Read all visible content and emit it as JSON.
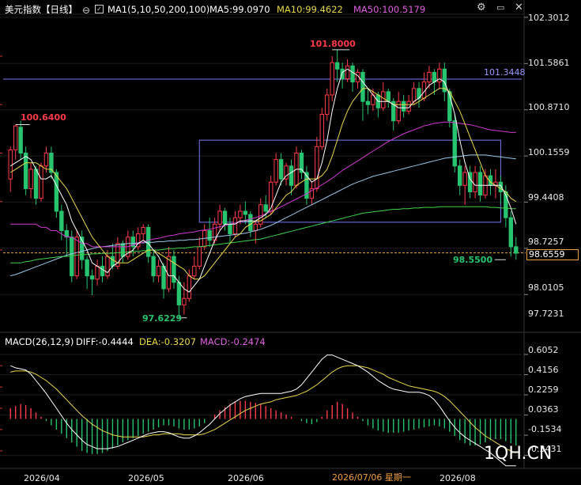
{
  "header": {
    "title": "美元指数【日线】",
    "ma_label": "MA1(5,10,50,200,100)",
    "ma5": "MA5:99.0970",
    "ma10": "MA10:99.4622",
    "ma50": "MA50:100.5179"
  },
  "macd_header": {
    "label": "MACD(26,12,9)",
    "diff": "DIFF:-0.4444",
    "dea": "DEA:-0.3207",
    "macd": "MACD:-0.2474"
  },
  "price_axis": [
    "102.3012",
    "101.5861",
    "100.8710",
    "100.1559",
    "99.4408",
    "98.7257",
    "98.0105",
    "97.7231"
  ],
  "current_price": "98.6559",
  "macd_axis": [
    "0.6052",
    "0.4156",
    "0.2259",
    "0.0363",
    "-0.1534",
    "-0.3431"
  ],
  "date_axis": [
    "2026/04",
    "2026/05",
    "2026/06",
    "2026/07/06 星期一",
    "2026/08"
  ],
  "annotations": {
    "high": "101.8000",
    "left_peak": "100.6400",
    "low": "97.6229",
    "recent_low": "98.5500",
    "hline": "101.3448"
  },
  "watermark": "1QH.CN",
  "colors": {
    "up": "#ff3b4a",
    "down": "#27c46f",
    "ma5": "#ffffff",
    "ma10": "#e8d94a",
    "ma50": "#d03ad0",
    "ma100": "#3ed34a",
    "ma200": "#9ac8e8",
    "box": "#7a78f0"
  },
  "chart_data": {
    "type": "candlestick",
    "ylim": [
      97.72,
      102.3
    ],
    "candles": [
      [
        99.8,
        100.25,
        99.6,
        100.3
      ],
      [
        100.25,
        100.62,
        100.1,
        100.64
      ],
      [
        100.6,
        100.2,
        100.1,
        100.7
      ],
      [
        100.2,
        99.65,
        99.55,
        100.3
      ],
      [
        99.65,
        99.95,
        99.5,
        100.05
      ],
      [
        99.95,
        99.5,
        99.4,
        100.0
      ],
      [
        99.5,
        100.0,
        99.45,
        100.05
      ],
      [
        100.0,
        100.2,
        99.9,
        100.3
      ],
      [
        100.2,
        99.9,
        99.8,
        100.3
      ],
      [
        99.9,
        99.3,
        99.2,
        99.95
      ],
      [
        99.3,
        99.0,
        98.85,
        99.4
      ],
      [
        99.0,
        98.9,
        98.6,
        99.1
      ],
      [
        98.9,
        98.3,
        98.2,
        99.0
      ],
      [
        98.3,
        98.9,
        98.25,
        99.0
      ],
      [
        98.9,
        98.55,
        98.4,
        99.0
      ],
      [
        98.55,
        98.3,
        98.1,
        98.6
      ],
      [
        98.3,
        98.25,
        98.0,
        98.4
      ],
      [
        98.25,
        98.45,
        98.15,
        98.55
      ],
      [
        98.45,
        98.3,
        98.2,
        98.6
      ],
      [
        98.3,
        98.6,
        98.25,
        98.7
      ],
      [
        98.6,
        98.45,
        98.4,
        98.8
      ],
      [
        98.45,
        98.8,
        98.4,
        98.9
      ],
      [
        98.8,
        98.6,
        98.5,
        98.85
      ],
      [
        98.6,
        98.9,
        98.55,
        99.0
      ],
      [
        98.9,
        98.75,
        98.6,
        99.0
      ],
      [
        98.75,
        98.95,
        98.7,
        99.05
      ],
      [
        98.95,
        99.05,
        98.85,
        99.1
      ],
      [
        99.05,
        98.6,
        98.5,
        99.1
      ],
      [
        98.6,
        98.3,
        98.2,
        98.7
      ],
      [
        98.3,
        98.45,
        98.2,
        98.55
      ],
      [
        98.45,
        98.1,
        97.95,
        98.5
      ],
      [
        98.1,
        98.6,
        98.05,
        98.75
      ],
      [
        98.6,
        98.2,
        98.1,
        98.7
      ],
      [
        98.2,
        97.85,
        97.65,
        98.3
      ],
      [
        97.85,
        97.95,
        97.7,
        98.2
      ],
      [
        97.95,
        98.3,
        97.9,
        98.4
      ],
      [
        98.3,
        98.45,
        98.25,
        98.6
      ],
      [
        98.45,
        98.75,
        98.4,
        98.9
      ],
      [
        98.75,
        99.0,
        98.7,
        99.1
      ],
      [
        99.0,
        98.85,
        98.75,
        99.2
      ],
      [
        98.85,
        99.1,
        98.8,
        99.2
      ],
      [
        99.1,
        99.3,
        99.0,
        99.4
      ],
      [
        99.3,
        99.1,
        99.0,
        99.35
      ],
      [
        99.1,
        98.95,
        98.8,
        99.2
      ],
      [
        98.95,
        99.2,
        98.9,
        99.3
      ],
      [
        99.2,
        99.3,
        99.1,
        99.4
      ],
      [
        99.3,
        99.25,
        99.1,
        99.45
      ],
      [
        99.25,
        99.0,
        98.9,
        99.3
      ],
      [
        99.0,
        99.1,
        98.8,
        99.15
      ],
      [
        99.1,
        99.4,
        99.05,
        99.5
      ],
      [
        99.4,
        99.3,
        99.2,
        99.55
      ],
      [
        99.3,
        99.75,
        99.25,
        99.85
      ],
      [
        99.75,
        100.1,
        99.7,
        100.2
      ],
      [
        100.1,
        99.8,
        99.7,
        100.2
      ],
      [
        99.8,
        100.0,
        99.7,
        100.05
      ],
      [
        100.0,
        99.7,
        99.55,
        100.1
      ],
      [
        99.7,
        100.2,
        99.65,
        100.3
      ],
      [
        100.2,
        99.9,
        99.8,
        100.25
      ],
      [
        99.9,
        99.5,
        99.4,
        100.0
      ],
      [
        99.5,
        99.65,
        99.4,
        99.75
      ],
      [
        99.65,
        100.3,
        99.6,
        100.45
      ],
      [
        100.3,
        100.8,
        100.25,
        100.9
      ],
      [
        100.8,
        101.1,
        100.7,
        101.2
      ],
      [
        101.1,
        101.6,
        101.0,
        101.7
      ],
      [
        101.6,
        101.5,
        101.3,
        101.8
      ],
      [
        101.5,
        101.35,
        101.2,
        101.6
      ],
      [
        101.35,
        101.55,
        101.3,
        101.65
      ],
      [
        101.55,
        101.3,
        101.15,
        101.6
      ],
      [
        101.3,
        101.45,
        101.2,
        101.5
      ],
      [
        101.45,
        101.0,
        100.7,
        101.5
      ],
      [
        101.0,
        100.95,
        100.8,
        101.2
      ],
      [
        100.95,
        101.1,
        100.85,
        101.2
      ],
      [
        101.1,
        100.9,
        100.75,
        101.15
      ],
      [
        100.9,
        101.15,
        100.85,
        101.3
      ],
      [
        101.15,
        101.0,
        100.9,
        101.2
      ],
      [
        101.0,
        100.7,
        100.55,
        101.05
      ],
      [
        100.7,
        101.0,
        100.65,
        101.15
      ],
      [
        101.0,
        100.85,
        100.75,
        101.1
      ],
      [
        100.85,
        101.0,
        100.8,
        101.1
      ],
      [
        101.0,
        101.2,
        100.95,
        101.3
      ],
      [
        101.2,
        101.05,
        100.9,
        101.3
      ],
      [
        101.05,
        101.3,
        101.0,
        101.45
      ],
      [
        101.3,
        101.45,
        101.2,
        101.55
      ],
      [
        101.45,
        101.3,
        101.1,
        101.5
      ],
      [
        101.3,
        101.5,
        101.2,
        101.6
      ],
      [
        101.5,
        101.15,
        101.0,
        101.6
      ],
      [
        101.15,
        100.7,
        100.6,
        101.2
      ],
      [
        100.7,
        100.0,
        99.9,
        100.8
      ],
      [
        100.0,
        99.7,
        99.55,
        100.1
      ],
      [
        99.7,
        99.9,
        99.4,
        100.0
      ],
      [
        99.9,
        99.6,
        99.5,
        100.0
      ],
      [
        99.6,
        99.9,
        99.5,
        100.0
      ],
      [
        99.9,
        99.55,
        99.45,
        100.0
      ],
      [
        99.55,
        99.85,
        99.5,
        99.95
      ],
      [
        99.85,
        99.7,
        99.55,
        99.95
      ],
      [
        99.7,
        99.75,
        99.5,
        99.95
      ],
      [
        99.75,
        99.6,
        99.4,
        99.85
      ],
      [
        99.6,
        99.2,
        99.05,
        99.7
      ],
      [
        99.2,
        98.75,
        98.6,
        99.3
      ],
      [
        98.75,
        98.65,
        98.55,
        98.9
      ]
    ],
    "ma5": [
      100.0,
      100.05,
      100.1,
      100.15,
      100.1,
      99.95,
      99.8,
      99.8,
      99.85,
      99.7,
      99.55,
      99.4,
      99.15,
      99.0,
      98.85,
      98.7,
      98.5,
      98.45,
      98.4,
      98.35,
      98.45,
      98.5,
      98.6,
      98.65,
      98.7,
      98.8,
      98.85,
      98.8,
      98.7,
      98.6,
      98.45,
      98.3,
      98.3,
      98.2,
      98.1,
      98.05,
      98.15,
      98.25,
      98.45,
      98.65,
      98.85,
      99.0,
      99.1,
      99.1,
      99.1,
      99.15,
      99.15,
      99.15,
      99.15,
      99.2,
      99.25,
      99.35,
      99.55,
      99.75,
      99.85,
      99.9,
      99.95,
      99.95,
      99.85,
      99.75,
      99.8,
      100.05,
      100.4,
      100.85,
      101.2,
      101.45,
      101.5,
      101.45,
      101.4,
      101.3,
      101.2,
      101.1,
      101.0,
      101.0,
      101.0,
      100.95,
      100.9,
      100.9,
      100.9,
      101.0,
      101.05,
      101.15,
      101.25,
      101.3,
      101.35,
      101.3,
      101.1,
      100.8,
      100.4,
      100.05,
      99.8,
      99.7,
      99.7,
      99.7,
      99.7,
      99.7,
      99.7,
      99.55,
      99.35,
      99.1
    ],
    "ma10": [
      99.9,
      99.95,
      100.0,
      100.05,
      100.05,
      100.05,
      100.0,
      99.95,
      99.95,
      99.85,
      99.75,
      99.65,
      99.5,
      99.35,
      99.2,
      99.05,
      98.9,
      98.8,
      98.7,
      98.6,
      98.55,
      98.5,
      98.5,
      98.5,
      98.55,
      98.6,
      98.65,
      98.7,
      98.7,
      98.65,
      98.6,
      98.55,
      98.5,
      98.45,
      98.4,
      98.3,
      98.25,
      98.25,
      98.3,
      98.4,
      98.5,
      98.6,
      98.7,
      98.8,
      98.9,
      98.95,
      99.05,
      99.1,
      99.15,
      99.15,
      99.2,
      99.25,
      99.35,
      99.45,
      99.55,
      99.6,
      99.7,
      99.75,
      99.8,
      99.8,
      99.8,
      99.85,
      99.95,
      100.15,
      100.4,
      100.65,
      100.85,
      101.0,
      101.1,
      101.2,
      101.2,
      101.15,
      101.1,
      101.05,
      101.0,
      100.95,
      100.95,
      100.95,
      100.95,
      100.95,
      101.0,
      101.05,
      101.1,
      101.15,
      101.2,
      101.2,
      101.15,
      101.0,
      100.85,
      100.65,
      100.45,
      100.25,
      100.05,
      99.85,
      99.75,
      99.7,
      99.65,
      99.6,
      99.5,
      99.45
    ],
    "ma50": [
      99.1,
      99.1,
      99.1,
      99.1,
      99.1,
      99.1,
      99.05,
      99.05,
      99.0,
      99.0,
      98.95,
      98.9,
      98.9,
      98.85,
      98.8,
      98.8,
      98.75,
      98.75,
      98.75,
      98.75,
      98.75,
      98.75,
      98.75,
      98.75,
      98.78,
      98.8,
      98.82,
      98.85,
      98.87,
      98.88,
      98.9,
      98.92,
      98.93,
      98.95,
      98.96,
      98.97,
      98.98,
      99.0,
      99.01,
      99.02,
      99.04,
      99.06,
      99.08,
      99.1,
      99.12,
      99.14,
      99.16,
      99.18,
      99.2,
      99.23,
      99.26,
      99.3,
      99.33,
      99.37,
      99.41,
      99.45,
      99.49,
      99.53,
      99.57,
      99.62,
      99.66,
      99.71,
      99.76,
      99.81,
      99.87,
      99.93,
      99.98,
      100.03,
      100.08,
      100.13,
      100.18,
      100.23,
      100.28,
      100.33,
      100.38,
      100.42,
      100.46,
      100.5,
      100.53,
      100.56,
      100.59,
      100.62,
      100.64,
      100.66,
      100.67,
      100.68,
      100.68,
      100.67,
      100.66,
      100.65,
      100.64,
      100.62,
      100.6,
      100.58,
      100.56,
      100.55,
      100.54,
      100.53,
      100.52,
      100.52
    ],
    "ma100": [
      98.5,
      98.5,
      98.5,
      98.52,
      98.53,
      98.55,
      98.56,
      98.57,
      98.58,
      98.59,
      98.6,
      98.6,
      98.61,
      98.62,
      98.63,
      98.63,
      98.64,
      98.64,
      98.65,
      98.65,
      98.65,
      98.66,
      98.66,
      98.67,
      98.68,
      98.68,
      98.69,
      98.69,
      98.7,
      98.7,
      98.71,
      98.72,
      98.72,
      98.73,
      98.73,
      98.74,
      98.75,
      98.75,
      98.76,
      98.77,
      98.78,
      98.79,
      98.8,
      98.81,
      98.82,
      98.83,
      98.84,
      98.85,
      98.86,
      98.87,
      98.89,
      98.91,
      98.93,
      98.95,
      98.97,
      98.99,
      99.01,
      99.03,
      99.05,
      99.07,
      99.09,
      99.11,
      99.13,
      99.15,
      99.17,
      99.19,
      99.21,
      99.23,
      99.25,
      99.27,
      99.28,
      99.29,
      99.3,
      99.31,
      99.32,
      99.33,
      99.33,
      99.34,
      99.34,
      99.35,
      99.35,
      99.36,
      99.36,
      99.36,
      99.37,
      99.37,
      99.37,
      99.37,
      99.37,
      99.37,
      99.37,
      99.37,
      99.37,
      99.37,
      99.36,
      99.36,
      99.35,
      99.35,
      99.34,
      99.34
    ],
    "ma200": [
      98.3,
      98.32,
      98.35,
      98.38,
      98.41,
      98.44,
      98.47,
      98.5,
      98.53,
      98.56,
      98.59,
      98.62,
      98.64,
      98.66,
      98.68,
      98.7,
      98.72,
      98.74,
      98.75,
      98.76,
      98.77,
      98.78,
      98.79,
      98.8,
      98.8,
      98.81,
      98.81,
      98.82,
      98.82,
      98.83,
      98.83,
      98.84,
      98.84,
      98.85,
      98.85,
      98.86,
      98.86,
      98.87,
      98.88,
      98.89,
      98.9,
      98.91,
      98.92,
      98.93,
      98.94,
      98.95,
      98.96,
      98.98,
      99.0,
      99.02,
      99.05,
      99.08,
      99.12,
      99.16,
      99.2,
      99.24,
      99.28,
      99.32,
      99.36,
      99.4,
      99.44,
      99.48,
      99.52,
      99.56,
      99.6,
      99.64,
      99.68,
      99.72,
      99.75,
      99.78,
      99.81,
      99.84,
      99.86,
      99.88,
      99.9,
      99.92,
      99.94,
      99.96,
      99.98,
      100.0,
      100.02,
      100.04,
      100.06,
      100.08,
      100.1,
      100.12,
      100.13,
      100.14,
      100.15,
      100.16,
      100.17,
      100.17,
      100.17,
      100.17,
      100.16,
      100.15,
      100.14,
      100.13,
      100.12,
      100.11
    ],
    "hline_value": 101.3448,
    "box": {
      "x0_index": 37,
      "x1_index": 96,
      "y_top": 100.4,
      "y_bottom": 99.13
    },
    "current_value": 98.6559,
    "macd_ylim": [
      -0.45,
      0.65
    ],
    "macd_hist": [
      0.1,
      0.12,
      0.14,
      0.13,
      0.1,
      0.06,
      0.02,
      -0.02,
      -0.06,
      -0.1,
      -0.14,
      -0.18,
      -0.22,
      -0.26,
      -0.3,
      -0.32,
      -0.33,
      -0.33,
      -0.32,
      -0.3,
      -0.28,
      -0.25,
      -0.22,
      -0.2,
      -0.18,
      -0.16,
      -0.14,
      -0.12,
      -0.1,
      -0.08,
      -0.06,
      -0.06,
      -0.07,
      -0.09,
      -0.1,
      -0.1,
      -0.09,
      -0.07,
      -0.04,
      0.0,
      0.04,
      0.08,
      0.11,
      0.14,
      0.16,
      0.17,
      0.17,
      0.16,
      0.15,
      0.14,
      0.12,
      0.1,
      0.08,
      0.06,
      0.04,
      0.02,
      0.0,
      -0.02,
      -0.04,
      -0.05,
      -0.03,
      0.02,
      0.08,
      0.13,
      0.16,
      0.14,
      0.1,
      0.06,
      0.02,
      -0.02,
      -0.06,
      -0.09,
      -0.11,
      -0.12,
      -0.13,
      -0.13,
      -0.13,
      -0.12,
      -0.11,
      -0.1,
      -0.09,
      -0.08,
      -0.07,
      -0.06,
      -0.07,
      -0.09,
      -0.12,
      -0.16,
      -0.2,
      -0.23,
      -0.25,
      -0.25,
      -0.24,
      -0.22,
      -0.2,
      -0.19,
      -0.19,
      -0.21,
      -0.23,
      -0.25
    ],
    "diff": [
      0.5,
      0.48,
      0.47,
      0.46,
      0.42,
      0.36,
      0.3,
      0.24,
      0.17,
      0.1,
      0.03,
      -0.04,
      -0.1,
      -0.15,
      -0.2,
      -0.24,
      -0.26,
      -0.28,
      -0.28,
      -0.28,
      -0.27,
      -0.26,
      -0.24,
      -0.22,
      -0.2,
      -0.18,
      -0.16,
      -0.14,
      -0.13,
      -0.12,
      -0.12,
      -0.13,
      -0.15,
      -0.17,
      -0.18,
      -0.18,
      -0.16,
      -0.13,
      -0.09,
      -0.05,
      0.0,
      0.05,
      0.09,
      0.13,
      0.16,
      0.19,
      0.21,
      0.22,
      0.23,
      0.24,
      0.24,
      0.24,
      0.24,
      0.24,
      0.25,
      0.26,
      0.28,
      0.32,
      0.38,
      0.44,
      0.5,
      0.56,
      0.6,
      0.6,
      0.58,
      0.56,
      0.54,
      0.52,
      0.5,
      0.47,
      0.44,
      0.4,
      0.36,
      0.33,
      0.3,
      0.28,
      0.27,
      0.26,
      0.25,
      0.25,
      0.25,
      0.24,
      0.22,
      0.18,
      0.12,
      0.05,
      -0.02,
      -0.08,
      -0.13,
      -0.17,
      -0.2,
      -0.23,
      -0.26,
      -0.29,
      -0.32,
      -0.36,
      -0.4,
      -0.44,
      -0.44,
      -0.44
    ],
    "dea": [
      0.44,
      0.45,
      0.45,
      0.45,
      0.44,
      0.42,
      0.39,
      0.36,
      0.32,
      0.28,
      0.23,
      0.18,
      0.13,
      0.08,
      0.03,
      -0.01,
      -0.05,
      -0.08,
      -0.11,
      -0.13,
      -0.15,
      -0.16,
      -0.17,
      -0.17,
      -0.17,
      -0.17,
      -0.17,
      -0.16,
      -0.15,
      -0.15,
      -0.14,
      -0.14,
      -0.14,
      -0.14,
      -0.15,
      -0.15,
      -0.15,
      -0.15,
      -0.14,
      -0.12,
      -0.1,
      -0.07,
      -0.04,
      -0.01,
      0.02,
      0.05,
      0.08,
      0.1,
      0.12,
      0.14,
      0.15,
      0.16,
      0.18,
      0.19,
      0.2,
      0.21,
      0.22,
      0.24,
      0.26,
      0.29,
      0.32,
      0.36,
      0.4,
      0.44,
      0.47,
      0.49,
      0.5,
      0.5,
      0.5,
      0.49,
      0.48,
      0.46,
      0.44,
      0.42,
      0.39,
      0.37,
      0.35,
      0.33,
      0.31,
      0.3,
      0.29,
      0.28,
      0.27,
      0.26,
      0.24,
      0.21,
      0.17,
      0.12,
      0.07,
      0.02,
      -0.03,
      -0.08,
      -0.12,
      -0.16,
      -0.19,
      -0.22,
      -0.25,
      -0.28,
      -0.3,
      -0.32
    ]
  }
}
